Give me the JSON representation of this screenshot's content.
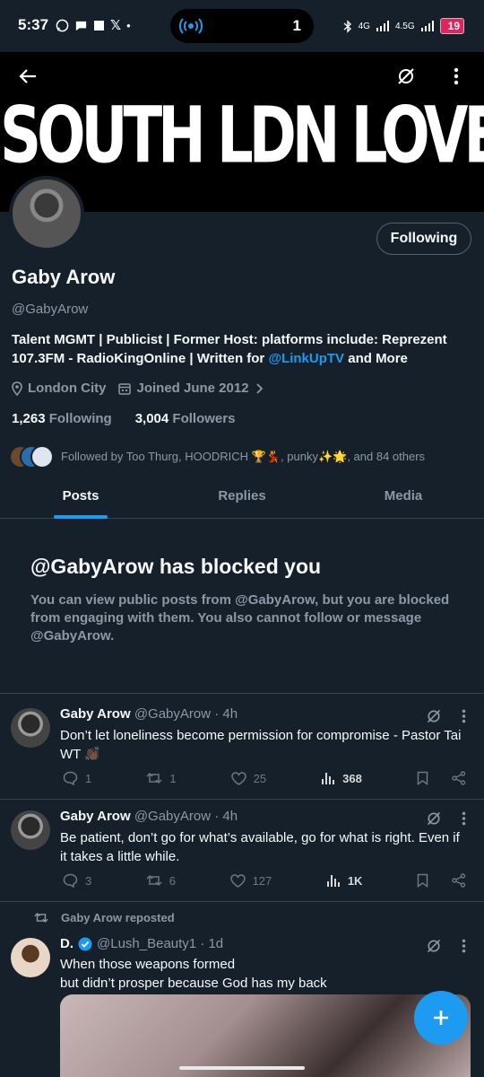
{
  "status_bar": {
    "time": "5:37",
    "left_icons": [
      "whatsapp-icon",
      "chat-icon",
      "square-icon",
      "x-icon",
      "dot"
    ],
    "pill_count": "1",
    "network": "4G",
    "network2": "4.5G",
    "battery": "19"
  },
  "banner": {
    "text": "SOUTH LDN LOVER GIRL"
  },
  "profile": {
    "following_button": "Following",
    "name": "Gaby Arow",
    "handle": "@GabyArow",
    "bio_text": "Talent MGMT | Publicist | Former Host: platforms include: Reprezent 107.3FM - RadioKingOnline | Written for ",
    "bio_link": "@LinkUpTV",
    "bio_end": " and More",
    "location": "London City",
    "joined": "Joined June 2012",
    "following_count": "1,263",
    "following_label": "Following",
    "followers_count": "3,004",
    "followers_label": "Followers",
    "followed_by": "Followed by Too Thurg, HOODRICH 🏆💃, punky✨🌟, and 84 others"
  },
  "tabs": [
    "Posts",
    "Replies",
    "Media"
  ],
  "blocked": {
    "title": "@GabyArow has blocked you",
    "message": "You can view public posts from @GabyArow, but you are blocked from engaging with them. You also cannot follow or message @GabyArow."
  },
  "tweets": [
    {
      "name": "Gaby Arow",
      "meta": "@GabyArow · 4h",
      "text": "Don’t let loneliness become permission for compromise - Pastor Tai WT 👏🏿",
      "replies": "1",
      "reposts": "1",
      "likes": "25",
      "views": "368"
    },
    {
      "name": "Gaby Arow",
      "meta": "@GabyArow · 4h",
      "text": "Be patient, don’t go for what’s available, go for what is right. Even if it takes a little while.",
      "replies": "3",
      "reposts": "6",
      "likes": "127",
      "views": "1K"
    },
    {
      "repost_label": "Gaby Arow reposted",
      "name": "D.",
      "meta": "@Lush_Beauty1 · 1d",
      "text_line1": "When those weapons formed",
      "text_line2": "but didn’t prosper because God has my back"
    }
  ],
  "colors": {
    "background": "#15202b",
    "accent": "#1d9bf0",
    "muted": "#8b98a5",
    "border": "#38444d"
  }
}
